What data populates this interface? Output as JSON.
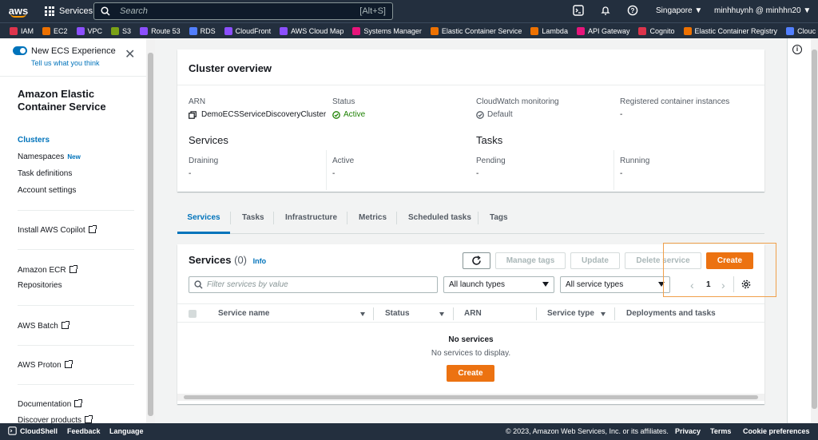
{
  "topnav": {
    "logo": "aws",
    "services_label": "Services",
    "search_placeholder": "Search",
    "search_shortcut": "[Alt+S]",
    "region": "Singapore",
    "user": "minhhuynh @ minhhn20",
    "icons": [
      "cloudshell-icon",
      "bell-icon",
      "help-icon"
    ]
  },
  "bookmarks": [
    {
      "label": "IAM",
      "color": "#dd344c"
    },
    {
      "label": "EC2",
      "color": "#ed7100"
    },
    {
      "label": "VPC",
      "color": "#8c4fff"
    },
    {
      "label": "S3",
      "color": "#7aa116"
    },
    {
      "label": "Route 53",
      "color": "#8c4fff"
    },
    {
      "label": "RDS",
      "color": "#527fff"
    },
    {
      "label": "CloudFront",
      "color": "#8c4fff"
    },
    {
      "label": "AWS Cloud Map",
      "color": "#8c4fff"
    },
    {
      "label": "Systems Manager",
      "color": "#e7157b"
    },
    {
      "label": "Elastic Container Service",
      "color": "#ed7100"
    },
    {
      "label": "Lambda",
      "color": "#ed7100"
    },
    {
      "label": "API Gateway",
      "color": "#e7157b"
    },
    {
      "label": "Cognito",
      "color": "#dd344c"
    },
    {
      "label": "Elastic Container Registry",
      "color": "#ed7100"
    },
    {
      "label": "Clouc",
      "color": "#527fff"
    }
  ],
  "sidebar": {
    "new_experience": "New ECS Experience",
    "tell_us": "Tell us what you think",
    "title": "Amazon Elastic Container Service",
    "links": {
      "clusters": "Clusters",
      "namespaces": "Namespaces",
      "namespaces_badge": "New",
      "task_definitions": "Task definitions",
      "account_settings": "Account settings",
      "install_copilot": "Install AWS Copilot",
      "amazon_ecr": "Amazon ECR",
      "repositories": "Repositories",
      "aws_batch": "AWS Batch",
      "aws_proton": "AWS Proton",
      "documentation": "Documentation",
      "discover_products": "Discover products"
    }
  },
  "overview": {
    "title": "Cluster overview",
    "arn_label": "ARN",
    "arn_value": "DemoECSServiceDiscoveryCluster",
    "status_label": "Status",
    "status_value": "Active",
    "cw_label": "CloudWatch monitoring",
    "cw_value": "Default",
    "reg_label": "Registered container instances",
    "reg_value": "-",
    "services_heading": "Services",
    "tasks_heading": "Tasks",
    "draining_label": "Draining",
    "draining_value": "-",
    "active_label": "Active",
    "active_value": "-",
    "pending_label": "Pending",
    "pending_value": "-",
    "running_label": "Running",
    "running_value": "-"
  },
  "tabs": [
    "Services",
    "Tasks",
    "Infrastructure",
    "Metrics",
    "Scheduled tasks",
    "Tags"
  ],
  "services_panel": {
    "title": "Services",
    "count": "(0)",
    "info": "Info",
    "manage_tags": "Manage tags",
    "update": "Update",
    "delete_service": "Delete service",
    "create": "Create",
    "filter_placeholder": "Filter services by value",
    "launch_types": "All launch types",
    "service_types": "All service types",
    "page": "1",
    "columns": [
      "Service name",
      "Status",
      "ARN",
      "Service type",
      "Deployments and tasks"
    ],
    "empty_title": "No services",
    "empty_text": "No services to display.",
    "empty_create": "Create"
  },
  "footer": {
    "cloudshell": "CloudShell",
    "feedback": "Feedback",
    "language": "Language",
    "copyright": "© 2023, Amazon Web Services, Inc. or its affiliates.",
    "privacy": "Privacy",
    "terms": "Terms",
    "cookies": "Cookie preferences"
  },
  "colors": {
    "nav_bg": "#232f3e",
    "accent": "#ec7211",
    "link": "#0073bb",
    "status_green": "#1d8102"
  }
}
